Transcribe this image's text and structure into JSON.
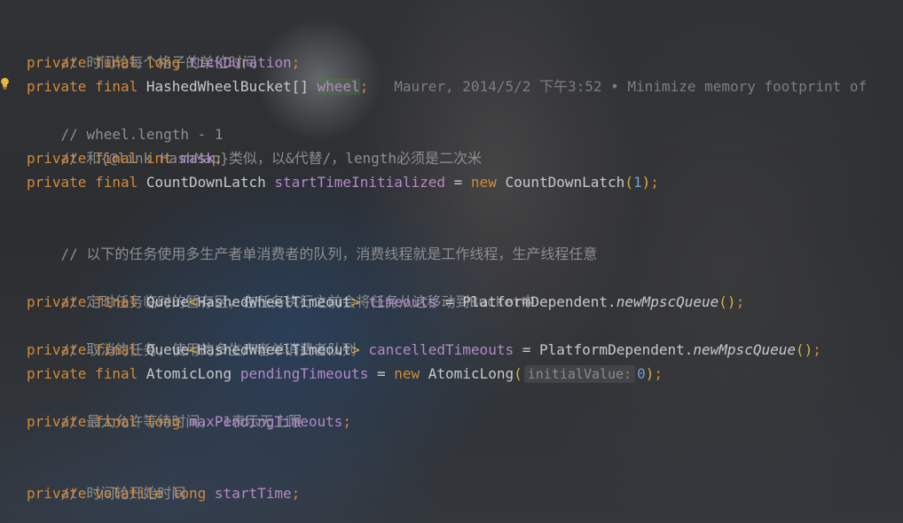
{
  "editor": {
    "lines": {
      "l1": {
        "comment": "// 时间轮每个格子的单位时间"
      },
      "l2": {
        "kw": "private final long ",
        "field": "tickDuration",
        "semi": ";"
      },
      "l3": {
        "kw": "private final ",
        "type": "HashedWheelBucket[] ",
        "field": "wheel",
        "semi": ";",
        "blame": "   Maurer, 2014/5/2 下午3:52 • Minimize memory footprint of"
      },
      "l4": {
        "comment": "// wheel.length - 1"
      },
      "l5": {
        "comment": "// 和{@link HashMap}类似，以&代替/，length必须是二次米"
      },
      "l6": {
        "kw": "private final int ",
        "field": "mask",
        "semi": ";"
      },
      "l7": {
        "kw": "private final ",
        "type": "CountDownLatch ",
        "field": "startTimeInitialized",
        "eq": " = ",
        "new": "new ",
        "ctor": "CountDownLatch",
        "open": "(",
        "num": "1",
        "close": ")",
        "semi": ";"
      },
      "l8": {
        "comment": "// 以下的任务使用多生产者单消费者的队列，消费线程就是工作线程，生产线程任意"
      },
      "l9": {
        "comment": "// 定时任务临时的暂存区，在任务执行之前会将任务从这移动到Bucket中"
      },
      "l10": {
        "kw": "private final ",
        "type1": "Queue",
        "lt": "<",
        "type2": "HashedWheelTimeout",
        "gt": "> ",
        "field": "timeouts",
        "eq": " = ",
        "cls": "PlatformDependent.",
        "method": "newMpscQueue",
        "open": "(",
        "close": ")",
        "semi": ";"
      },
      "l11": {
        "comment": "// 取消的任务，使用的多生产者单消费者队列"
      },
      "l12": {
        "kw": "private final ",
        "type1": "Queue",
        "lt": "<",
        "type2": "HashedWheelTimeout",
        "gt": "> ",
        "field": "cancelledTimeouts",
        "eq": " = ",
        "cls": "PlatformDependent.",
        "method": "newMpscQueue",
        "open": "(",
        "close": ")",
        "semi": ";"
      },
      "l13": {
        "kw": "private final ",
        "type": "AtomicLong ",
        "field": "pendingTimeouts",
        "eq": " = ",
        "new": "new ",
        "ctor": "AtomicLong",
        "open": "(",
        "hint": "initialValue:",
        "num": "0",
        "close": ")",
        "semi": ";"
      },
      "l14": {
        "comment": "// 最大允许等待时间，-1表示无上限"
      },
      "l15": {
        "kw": "private final long ",
        "field": "maxPendingTimeouts",
        "semi": ";"
      },
      "l16": {
        "comment": "// 时间轮开始时间"
      },
      "l17": {
        "kw": "private volatile long ",
        "field": "startTime",
        "semi": ";"
      }
    }
  },
  "icons": {
    "gutter": "lightbulb-icon"
  },
  "colors": {
    "keyword": "#d08a3a",
    "field": "#b389c8",
    "comment": "#8d8e90",
    "number": "#6f9fd6",
    "paren": "#d6b13f",
    "bulb": "#e8b93a"
  }
}
